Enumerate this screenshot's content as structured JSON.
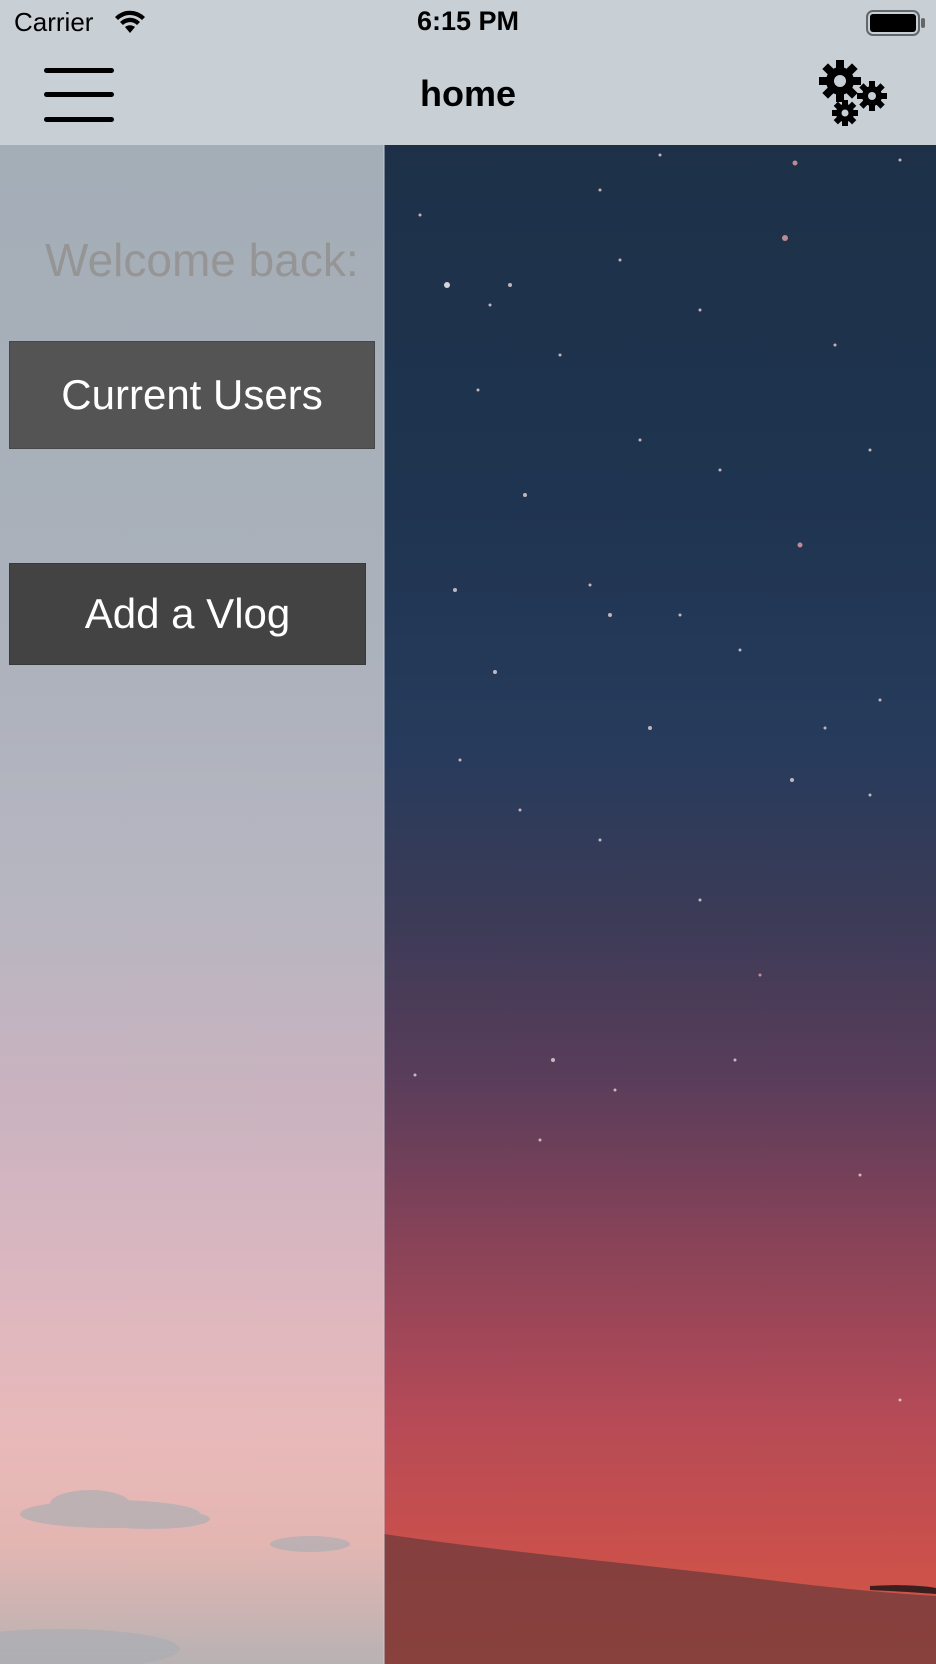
{
  "status_bar": {
    "carrier": "Carrier",
    "time": "6:15 PM"
  },
  "nav_bar": {
    "title": "home",
    "menu_icon": "hamburger-menu-icon",
    "settings_icon": "gears-icon"
  },
  "drawer": {
    "welcome_text": "Welcome back:",
    "buttons": [
      {
        "label": "Current Users"
      },
      {
        "label": "Add a Vlog"
      }
    ]
  },
  "colors": {
    "nav_bar_bg": "#c8cfd5",
    "button_users_bg": "#545454",
    "button_vlog_bg": "#434343",
    "welcome_text": "#959596"
  }
}
